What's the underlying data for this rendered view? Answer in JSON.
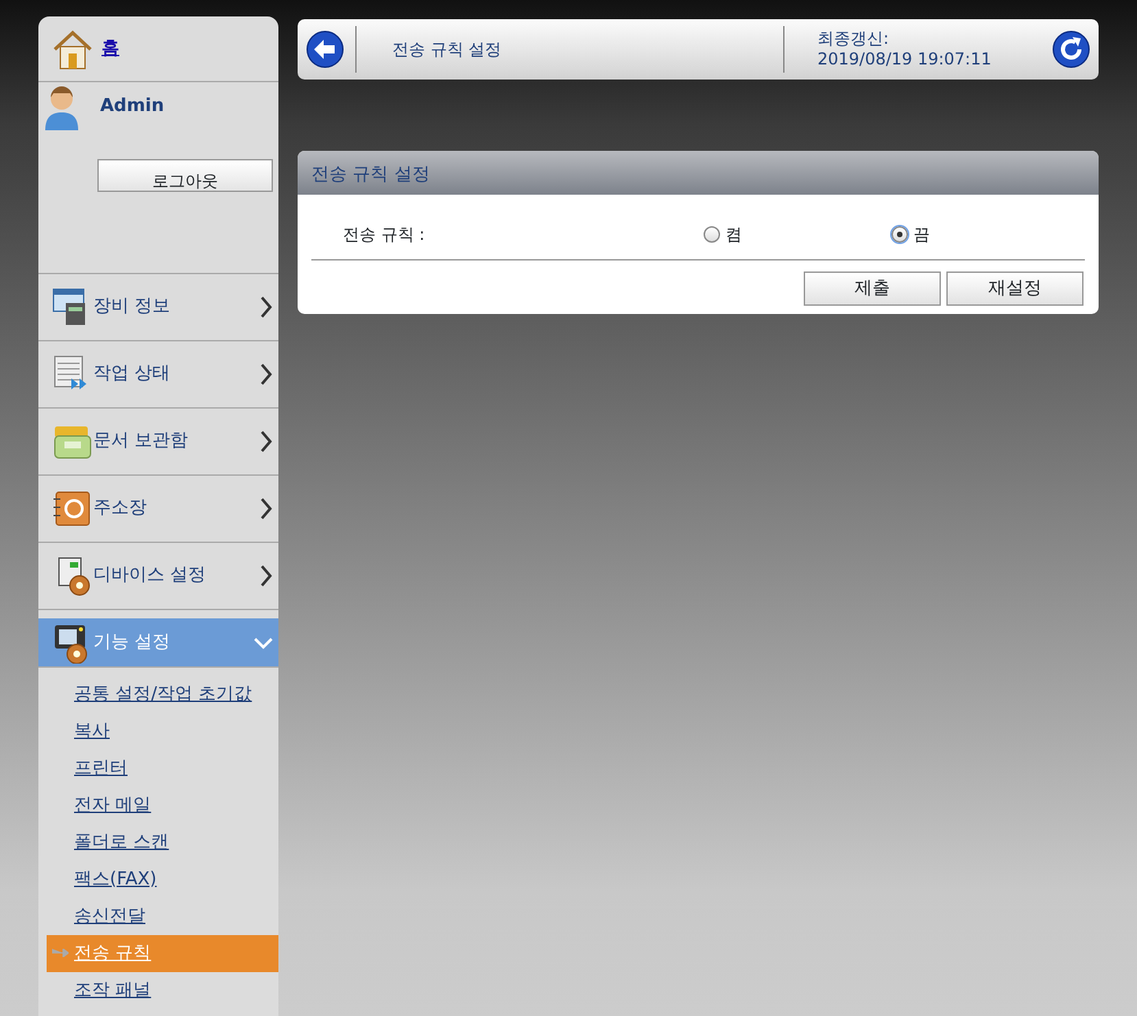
{
  "sidebar": {
    "home": {
      "label": "홈"
    },
    "user": {
      "name": "Admin"
    },
    "logout_button": "로그아웃",
    "menu": [
      {
        "label": "장비 정보",
        "kind": "device-info",
        "expanded": false
      },
      {
        "label": "작업 상태",
        "kind": "job-status",
        "expanded": false
      },
      {
        "label": "문서 보관함",
        "kind": "document-box",
        "expanded": false
      },
      {
        "label": "주소장",
        "kind": "address-book",
        "expanded": false
      },
      {
        "label": "디바이스 설정",
        "kind": "device-settings",
        "expanded": false
      },
      {
        "label": "기능 설정",
        "kind": "function-settings",
        "expanded": true,
        "children": [
          {
            "label": "공통 설정/작업 초기값",
            "selected": false
          },
          {
            "label": "복사",
            "selected": false
          },
          {
            "label": "프린터",
            "selected": false
          },
          {
            "label": "전자 메일",
            "selected": false
          },
          {
            "label": "폴더로 스캔",
            "selected": false
          },
          {
            "label": "팩스(FAX)",
            "selected": false
          },
          {
            "label": "송신전달",
            "selected": false
          },
          {
            "label": "전송 규칙",
            "selected": true
          },
          {
            "label": "조작 패널",
            "selected": false
          }
        ]
      }
    ]
  },
  "header": {
    "title": "전송 규칙 설정",
    "last_updated_label": "최종갱신:",
    "last_updated": "2019/08/19 19:07:11"
  },
  "panel": {
    "title": "전송 규칙 설정",
    "field": {
      "label": "전송 규칙 :",
      "options": [
        {
          "label": "켬",
          "selected": false
        },
        {
          "label": "끔",
          "selected": true
        }
      ]
    },
    "buttons": [
      "제출",
      "재설정"
    ]
  }
}
